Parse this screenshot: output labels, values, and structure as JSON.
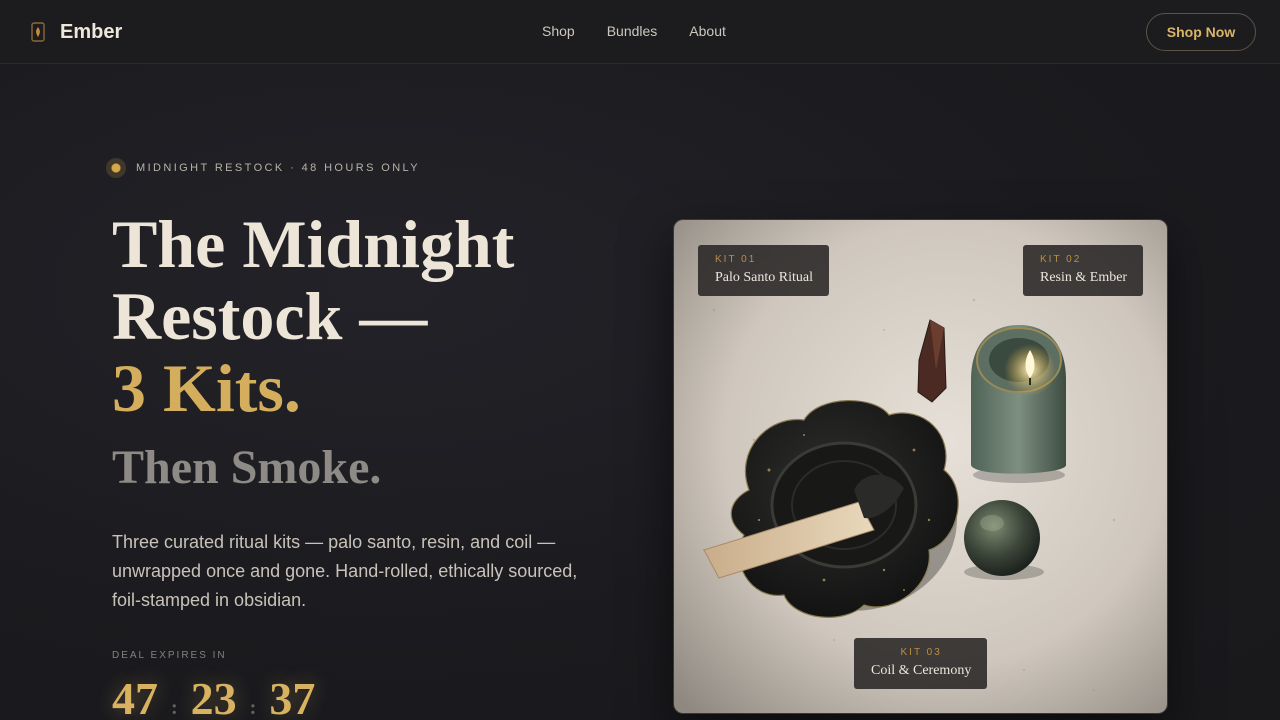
{
  "brand": {
    "name": "Ember",
    "logo": "ember-flame-icon"
  },
  "nav": {
    "links": [
      "Shop",
      "Bundles",
      "About"
    ],
    "cta": "Shop Now"
  },
  "hero": {
    "eyebrow": "MIDNIGHT RESTOCK · 48 HOURS ONLY",
    "headline_line1": "The Midnight",
    "headline_line2": "Restock —",
    "headline_line3": "3 Kits.",
    "subheadline": "Then Smoke.",
    "description": "Three curated ritual kits — palo santo, resin, and coil — unwrapped once and gone. Hand-rolled, ethically sourced, foil-stamped in obsidian.",
    "countdown_label": "DEAL EXPIRES IN",
    "countdown": {
      "hours": "47",
      "minutes": "23",
      "seconds": "37",
      "separator": ":"
    }
  },
  "kits": [
    {
      "label": "KIT 01",
      "name": "Palo Santo Ritual"
    },
    {
      "label": "KIT 02",
      "name": "Resin & Ember"
    },
    {
      "label": "KIT 03",
      "name": "Coil & Ceremony"
    }
  ],
  "colors": {
    "accent_gold": "#d4ae5c",
    "background": "#1b1b1f",
    "text": "#ece5d8"
  }
}
